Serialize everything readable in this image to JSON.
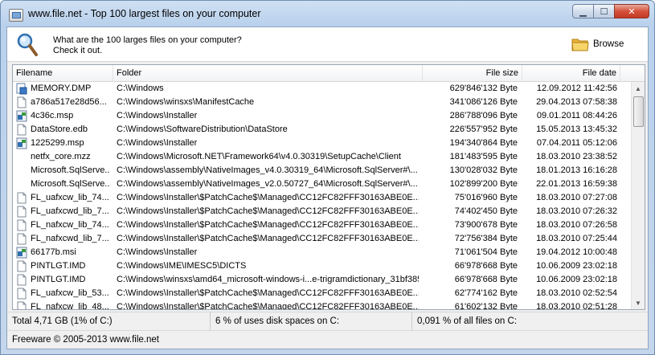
{
  "window": {
    "title": "www.file.net - Top 100 largest files on your computer",
    "buttons": {
      "minimize": "▁",
      "maximize": "☐",
      "close": "✕"
    }
  },
  "header": {
    "line1": "What are the 100 larges files on your computer?",
    "line2": "Check it out.",
    "browse_label": "Browse"
  },
  "columns": {
    "filename": "Filename",
    "folder": "Folder",
    "size": "File size",
    "date": "File date"
  },
  "rows": [
    {
      "icon": "system-file-icon",
      "name": "MEMORY.DMP",
      "folder": "C:\\Windows",
      "size": "629'846'132 Byte",
      "date": "12.09.2012 11:42:56"
    },
    {
      "icon": "document-icon",
      "name": "a786a517e28d56...",
      "folder": "C:\\Windows\\winsxs\\ManifestCache",
      "size": "341'086'126 Byte",
      "date": "29.04.2013 07:58:38"
    },
    {
      "icon": "installer-icon",
      "name": "4c36c.msp",
      "folder": "C:\\Windows\\Installer",
      "size": "286'788'096 Byte",
      "date": "09.01.2011 08:44:26"
    },
    {
      "icon": "document-icon",
      "name": "DataStore.edb",
      "folder": "C:\\Windows\\SoftwareDistribution\\DataStore",
      "size": "226'557'952 Byte",
      "date": "15.05.2013 13:45:32"
    },
    {
      "icon": "installer-icon",
      "name": "1225299.msp",
      "folder": "C:\\Windows\\Installer",
      "size": "194'340'864 Byte",
      "date": "07.04.2011 05:12:06"
    },
    {
      "icon": "none",
      "name": "netfx_core.mzz",
      "folder": "C:\\Windows\\Microsoft.NET\\Framework64\\v4.0.30319\\SetupCache\\Client",
      "size": "181'483'595 Byte",
      "date": "18.03.2010 23:38:52"
    },
    {
      "icon": "none",
      "name": "Microsoft.SqlServe...",
      "folder": "C:\\Windows\\assembly\\NativeImages_v4.0.30319_64\\Microsoft.SqlServer#\\...",
      "size": "130'028'032 Byte",
      "date": "18.01.2013 16:16:28"
    },
    {
      "icon": "none",
      "name": "Microsoft.SqlServe...",
      "folder": "C:\\Windows\\assembly\\NativeImages_v2.0.50727_64\\Microsoft.SqlServer#\\...",
      "size": "102'899'200 Byte",
      "date": "22.01.2013 16:59:38"
    },
    {
      "icon": "document-icon",
      "name": "FL_uafxcw_lib_74...",
      "folder": "C:\\Windows\\Installer\\$PatchCache$\\Managed\\CC12FC82FFF30163ABE0E...",
      "size": "75'016'960 Byte",
      "date": "18.03.2010 07:27:08"
    },
    {
      "icon": "document-icon",
      "name": "FL_uafxcwd_lib_7...",
      "folder": "C:\\Windows\\Installer\\$PatchCache$\\Managed\\CC12FC82FFF30163ABE0E...",
      "size": "74'402'450 Byte",
      "date": "18.03.2010 07:26:32"
    },
    {
      "icon": "document-icon",
      "name": "FL_nafxcw_lib_74...",
      "folder": "C:\\Windows\\Installer\\$PatchCache$\\Managed\\CC12FC82FFF30163ABE0E...",
      "size": "73'900'678 Byte",
      "date": "18.03.2010 07:26:58"
    },
    {
      "icon": "document-icon",
      "name": "FL_nafxcwd_lib_7...",
      "folder": "C:\\Windows\\Installer\\$PatchCache$\\Managed\\CC12FC82FFF30163ABE0E...",
      "size": "72'756'384 Byte",
      "date": "18.03.2010 07:25:44"
    },
    {
      "icon": "installer-icon",
      "name": "66177b.msi",
      "folder": "C:\\Windows\\Installer",
      "size": "71'061'504 Byte",
      "date": "19.04.2012 10:00:48"
    },
    {
      "icon": "document-icon",
      "name": "PINTLGT.IMD",
      "folder": "C:\\Windows\\IME\\IMESC5\\DICTS",
      "size": "66'978'668 Byte",
      "date": "10.06.2009 23:02:18"
    },
    {
      "icon": "document-icon",
      "name": "PINTLGT.IMD",
      "folder": "C:\\Windows\\winsxs\\amd64_microsoft-windows-i...e-trigramdictionary_31bf385...",
      "size": "66'978'668 Byte",
      "date": "10.06.2009 23:02:18"
    },
    {
      "icon": "document-icon",
      "name": "FL_uafxcw_lib_53...",
      "folder": "C:\\Windows\\Installer\\$PatchCache$\\Managed\\CC12FC82FFF30163ABE0E...",
      "size": "62'774'162 Byte",
      "date": "18.03.2010 02:52:54"
    },
    {
      "icon": "document-icon",
      "name": "FL_nafxcw_lib_48...",
      "folder": "C:\\Windows\\Installer\\$PatchCache$\\Managed\\CC12FC82FFF30163ABE0E...",
      "size": "61'602'132 Byte",
      "date": "18.03.2010 02:51:28"
    }
  ],
  "status": {
    "total": "Total 4,71 GB (1% of C:)",
    "disk": "6 % of uses disk spaces on C:",
    "files": "0,091 % of all files on C:"
  },
  "footer": {
    "copyright": "Freeware © 2005-2013 www.file.net"
  }
}
